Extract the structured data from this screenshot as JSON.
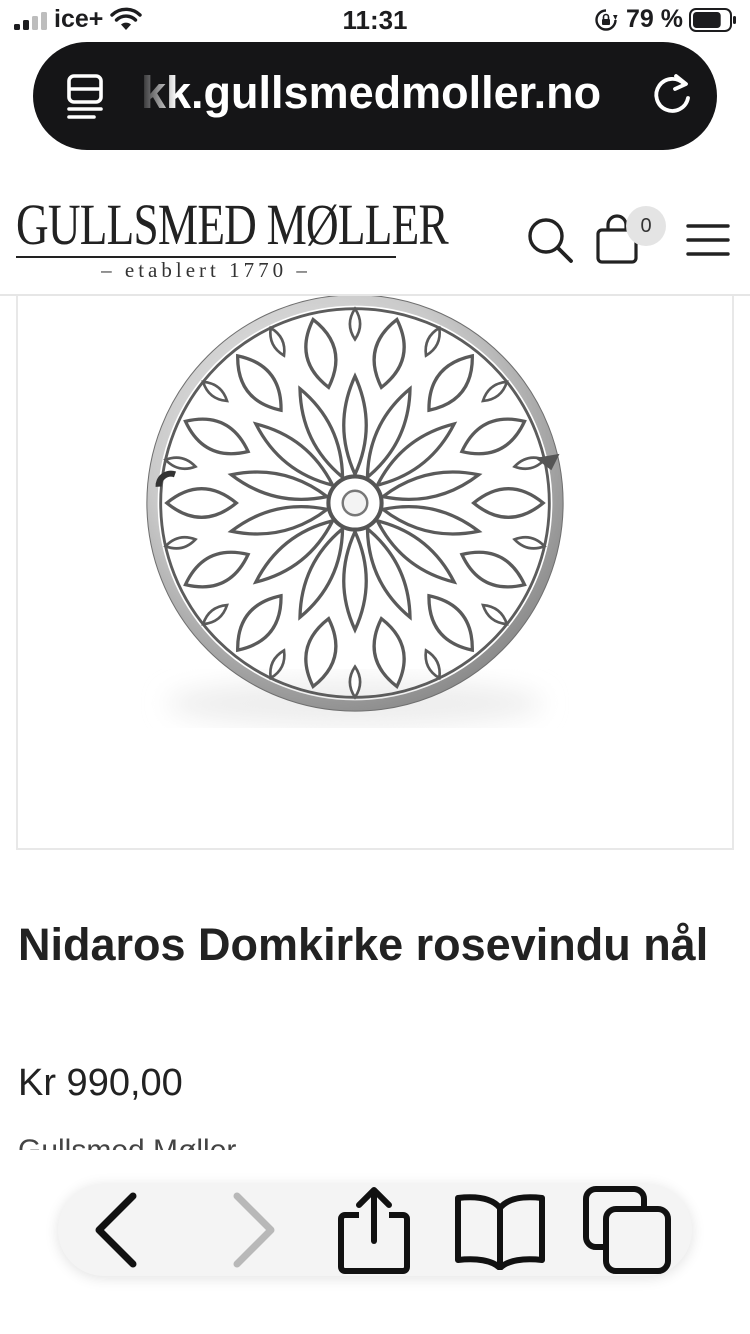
{
  "status_bar": {
    "carrier": "ice+",
    "time": "11:31",
    "battery_percent": "79 %",
    "battery_level": 0.79,
    "icons": [
      "signal-icon",
      "wifi-icon",
      "rotation-lock-icon",
      "battery-icon"
    ]
  },
  "browser": {
    "url_text": "kk.gullsmedmoller.no",
    "icons": {
      "reader": "reader-mode-icon",
      "reload": "reload-icon"
    }
  },
  "site_header": {
    "logo_name": "GULLSMED MØLLER",
    "logo_tagline": "– etablert 1770 –",
    "cart_count": "0",
    "icons": {
      "search": "search-icon",
      "cart": "shopping-bag-icon",
      "menu": "hamburger-menu-icon"
    }
  },
  "product": {
    "title": "Nidaros Domkirke rosevindu nål",
    "price": "Kr 990,00",
    "vendor": "Gullsmed Møller",
    "image_icon": "rose-window-brooch-image"
  },
  "toolbar": {
    "icons": [
      "back-icon",
      "forward-icon",
      "share-icon",
      "bookmarks-icon",
      "tabs-icon"
    ]
  }
}
